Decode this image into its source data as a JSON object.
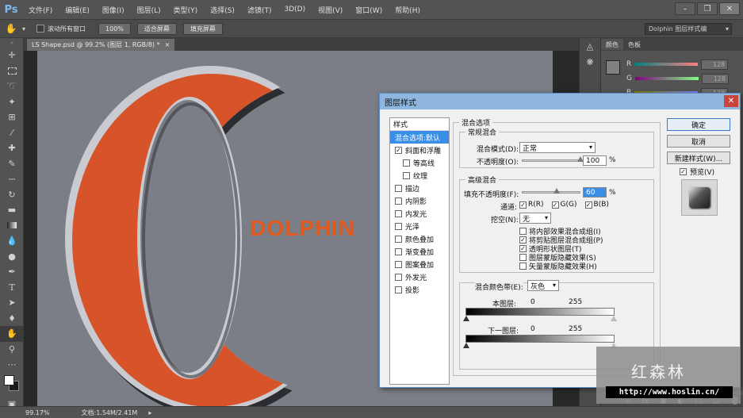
{
  "app": {
    "logo": "Ps",
    "menus": [
      "文件(F)",
      "编辑(E)",
      "图像(I)",
      "图层(L)",
      "类型(Y)",
      "选择(S)",
      "滤镜(T)",
      "3D(D)",
      "视图(V)",
      "窗口(W)",
      "帮助(H)"
    ]
  },
  "optbar": {
    "scroll_all_label": "滚动所有窗口",
    "zoom_100": "100%",
    "fit_screen": "适合屏幕",
    "fill_screen": "填充屏幕",
    "workspace": "Dolphin 图层样式编"
  },
  "document": {
    "tab_title": "LS Shape.psd @ 99.2% (图层 1, RGB/8) *",
    "canvas_text": "DOLPHIN",
    "canvas_text_color": "#e05a20",
    "shape_color": "#d7542a"
  },
  "status": {
    "zoom": "99.17%",
    "doc_size": "文档:1.54M/2.41M"
  },
  "panel": {
    "tabs": [
      "颜色",
      "色板"
    ],
    "rows": [
      {
        "label": "R",
        "value": "128"
      },
      {
        "label": "G",
        "value": "128"
      },
      {
        "label": "B",
        "value": "128"
      }
    ]
  },
  "dialog": {
    "title": "图层样式",
    "styles_header": "样式",
    "style_items": [
      {
        "label": "混合选项:默认",
        "selected": true,
        "checkbox": false,
        "sub": false
      },
      {
        "label": "斜面和浮雕",
        "checked": true,
        "checkbox": true,
        "sub": false
      },
      {
        "label": "等高线",
        "checked": false,
        "checkbox": true,
        "sub": true
      },
      {
        "label": "纹理",
        "checked": false,
        "checkbox": true,
        "sub": true
      },
      {
        "label": "描边",
        "checked": false,
        "checkbox": true,
        "sub": false
      },
      {
        "label": "内阴影",
        "checked": false,
        "checkbox": true,
        "sub": false
      },
      {
        "label": "内发光",
        "checked": false,
        "checkbox": true,
        "sub": false
      },
      {
        "label": "光泽",
        "checked": false,
        "checkbox": true,
        "sub": false
      },
      {
        "label": "颜色叠加",
        "checked": false,
        "checkbox": true,
        "sub": false
      },
      {
        "label": "渐变叠加",
        "checked": false,
        "checkbox": true,
        "sub": false
      },
      {
        "label": "图案叠加",
        "checked": false,
        "checkbox": true,
        "sub": false
      },
      {
        "label": "外发光",
        "checked": false,
        "checkbox": true,
        "sub": false
      },
      {
        "label": "投影",
        "checked": false,
        "checkbox": true,
        "sub": false
      }
    ],
    "blend_options_title": "混合选项",
    "general_title": "常规混合",
    "blend_mode_label": "混合模式(D):",
    "blend_mode_value": "正常",
    "opacity_label": "不透明度(O):",
    "opacity_value": "100",
    "opacity_level": 1.0,
    "advanced_title": "高级混合",
    "fill_opacity_label": "填充不透明度(F):",
    "fill_opacity_value": "60",
    "fill_opacity_level": 0.6,
    "channels_label": "通道:",
    "channels": [
      {
        "label": "R(R)",
        "checked": true
      },
      {
        "label": "G(G)",
        "checked": true
      },
      {
        "label": "B(B)",
        "checked": true
      }
    ],
    "knockout_label": "挖空(N):",
    "knockout_value": "无",
    "advanced_options": [
      {
        "label": "将内部效果混合成组(I)",
        "checked": false
      },
      {
        "label": "将剪贴图层混合成组(P)",
        "checked": true
      },
      {
        "label": "透明形状图层(T)",
        "checked": true
      },
      {
        "label": "图层蒙版隐藏效果(S)",
        "checked": false
      },
      {
        "label": "矢量蒙版隐藏效果(H)",
        "checked": false
      }
    ],
    "blend_if_label": "混合颜色带(E):",
    "blend_if_value": "灰色",
    "this_layer_label": "本图层:",
    "this_layer_min": "0",
    "this_layer_max": "255",
    "under_layer_label": "下一图层:",
    "under_layer_min": "0",
    "under_layer_max": "255",
    "percent": "%",
    "ok": "确定",
    "cancel": "取消",
    "new_style": "新建样式(W)...",
    "preview_label": "预览(V)",
    "preview_checked": true
  },
  "watermark": {
    "cn": "红森林",
    "url": "http://www.hoslin.cn/"
  }
}
